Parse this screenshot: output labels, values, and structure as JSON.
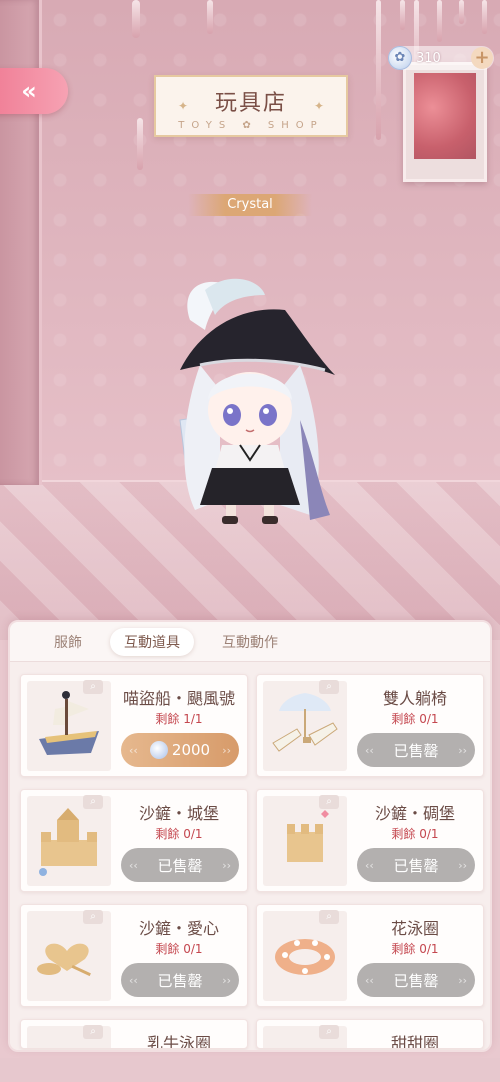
{
  "header": {
    "shop_title_cn": "玩具店",
    "shop_title_en": "TOYS ✿ SHOP",
    "character_name": "Crystal",
    "currency_amount": "310",
    "back_icon": "double-chevron-left-icon",
    "plus_icon": "plus-icon"
  },
  "tabs": [
    {
      "label": "服飾",
      "active": false
    },
    {
      "label": "互動道具",
      "active": true
    },
    {
      "label": "互動動作",
      "active": false
    }
  ],
  "items": [
    {
      "title": "喵盜船・颶風號",
      "remain": "剩餘 1/1",
      "button": "2000",
      "status": "buy"
    },
    {
      "title": "雙人躺椅",
      "remain": "剩餘 0/1",
      "button": "已售罄",
      "status": "sold"
    },
    {
      "title": "沙鏟・城堡",
      "remain": "剩餘 0/1",
      "button": "已售罄",
      "status": "sold"
    },
    {
      "title": "沙鏟・碉堡",
      "remain": "剩餘 0/1",
      "button": "已售罄",
      "status": "sold"
    },
    {
      "title": "沙鏟・愛心",
      "remain": "剩餘 0/1",
      "button": "已售罄",
      "status": "sold"
    },
    {
      "title": "花泳圈",
      "remain": "剩餘 0/1",
      "button": "已售罄",
      "status": "sold"
    },
    {
      "title": "乳牛泳圈",
      "remain": "",
      "button": "",
      "status": "partial"
    },
    {
      "title": "甜甜圈",
      "remain": "",
      "button": "",
      "status": "partial"
    }
  ],
  "colors": {
    "accent_buy": "#d79b6a",
    "sold_gray": "#b3b0af",
    "remain_red": "#c4474f",
    "back_pink": "#f07d95"
  }
}
